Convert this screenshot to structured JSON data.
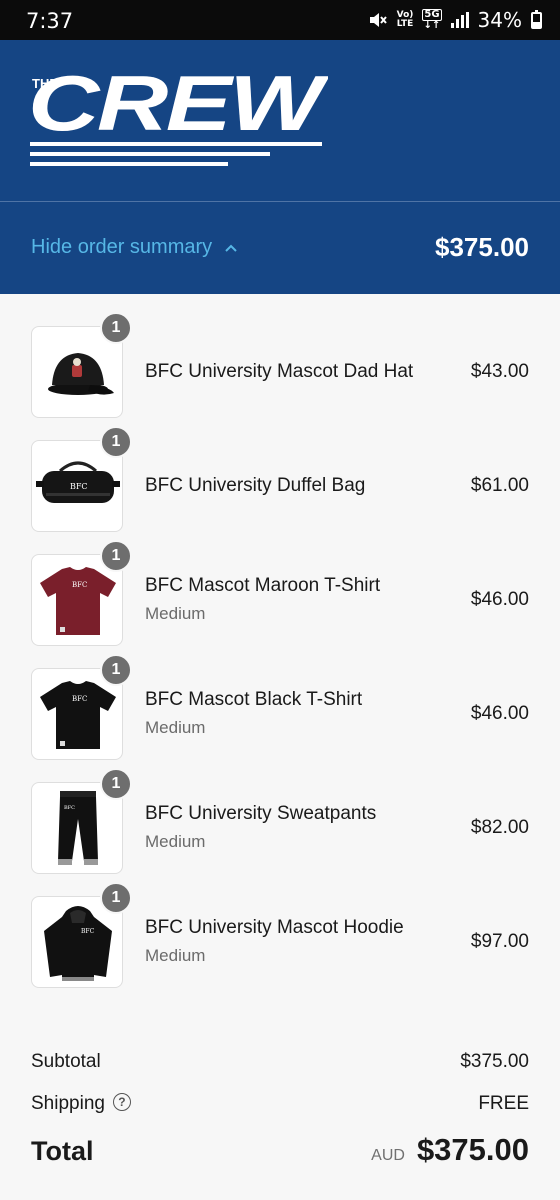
{
  "status_bar": {
    "time": "7:37",
    "volte_top": "Vo)",
    "volte_bottom": "LTE",
    "network": "5G",
    "battery": "34%",
    "battery_level": 0.34,
    "icons": [
      "mute-icon",
      "volte-icon",
      "5g-icon",
      "signal-icon",
      "battery-icon"
    ]
  },
  "brand": {
    "logo_small": "THE",
    "logo_big": "CREW"
  },
  "summary": {
    "toggle_label": "Hide order summary",
    "toggle_icon": "chevron-up-icon",
    "total": "$375.00"
  },
  "items": [
    {
      "name": "BFC University Mascot Dad Hat",
      "variant": "",
      "price": "$43.00",
      "qty": "1",
      "icon": "dad-hat-image"
    },
    {
      "name": "BFC University Duffel Bag",
      "variant": "",
      "price": "$61.00",
      "qty": "1",
      "icon": "duffel-bag-image"
    },
    {
      "name": "BFC Mascot Maroon T-Shirt",
      "variant": "Medium",
      "price": "$46.00",
      "qty": "1",
      "icon": "maroon-tshirt-image"
    },
    {
      "name": "BFC Mascot Black T-Shirt",
      "variant": "Medium",
      "price": "$46.00",
      "qty": "1",
      "icon": "black-tshirt-image"
    },
    {
      "name": "BFC University Sweatpants",
      "variant": "Medium",
      "price": "$82.00",
      "qty": "1",
      "icon": "sweatpants-image"
    },
    {
      "name": "BFC University Mascot Hoodie",
      "variant": "Medium",
      "price": "$97.00",
      "qty": "1",
      "icon": "hoodie-image"
    }
  ],
  "totals": {
    "subtotal_label": "Subtotal",
    "subtotal_value": "$375.00",
    "shipping_label": "Shipping",
    "shipping_value": "FREE",
    "total_label": "Total",
    "currency": "AUD",
    "total_value": "$375.00"
  },
  "colors": {
    "header_bg": "#154584",
    "accent_link": "#56b7e6",
    "badge": "#6e6e6e",
    "maroon": "#7a1f2b"
  }
}
